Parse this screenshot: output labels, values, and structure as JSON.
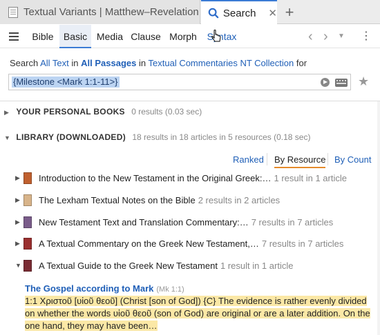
{
  "tabs": {
    "doc_tab_title": "Textual Variants | Matthew–Revelation",
    "search_tab_title": "Search",
    "close_glyph": "✕",
    "add_glyph": "+"
  },
  "modes": [
    "Bible",
    "Basic",
    "Media",
    "Clause",
    "Morph",
    "Syntax"
  ],
  "active_mode": "Basic",
  "search_line": {
    "prefix": "Search",
    "scope_text": "All Text",
    "in1": "in",
    "scope_passage": "All Passages",
    "in2": "in",
    "collection": "Textual Commentaries NT Collection",
    "suffix": "for"
  },
  "query": "{Milestone <Mark 1:1-11>}",
  "personal": {
    "title": "YOUR PERSONAL BOOKS",
    "count": "0 results (0.03 sec)"
  },
  "library": {
    "title": "LIBRARY (DOWNLOADED)",
    "count": "18 results in 18 articles in 5 resources (0.18 sec)"
  },
  "sort": {
    "ranked": "Ranked",
    "by_resource": "By Resource",
    "by_count": "By Count"
  },
  "resources": [
    {
      "title": "Introduction to the New Testament in the Original Greek:…",
      "count": "1 result in 1 article",
      "color": "#c0602f"
    },
    {
      "title": "The Lexham Textual Notes on the Bible",
      "count": "2 results in 2 articles",
      "color": "#d8b48a"
    },
    {
      "title": "New Testament Text and Translation Commentary:…",
      "count": "7 results in 7 articles",
      "color": "#7a5c8a"
    },
    {
      "title": "A Textual Commentary on the Greek New Testament,…",
      "count": "7 results in 7 articles",
      "color": "#9a2f2f"
    },
    {
      "title": "A Textual Guide to the Greek New Testament",
      "count": "1 result in 1 article",
      "color": "#7a2c34"
    }
  ],
  "hit": {
    "title": "The Gospel according to Mark",
    "ref": "(Mk 1:1)",
    "text": "1:1 Χριστοῦ [υἱοῦ θεοῦ] (Christ [son of God]) {C} The evidence is rather evenly divided on whether the words υἱοῦ θεοῦ (son of God) are original or are a later addition. On the one hand, they may have been…"
  },
  "colors": {
    "link": "#1f5fb7",
    "accent": "#3a7bd5",
    "highlight": "#fbe8a6",
    "sort_underline": "#e58a2b"
  }
}
